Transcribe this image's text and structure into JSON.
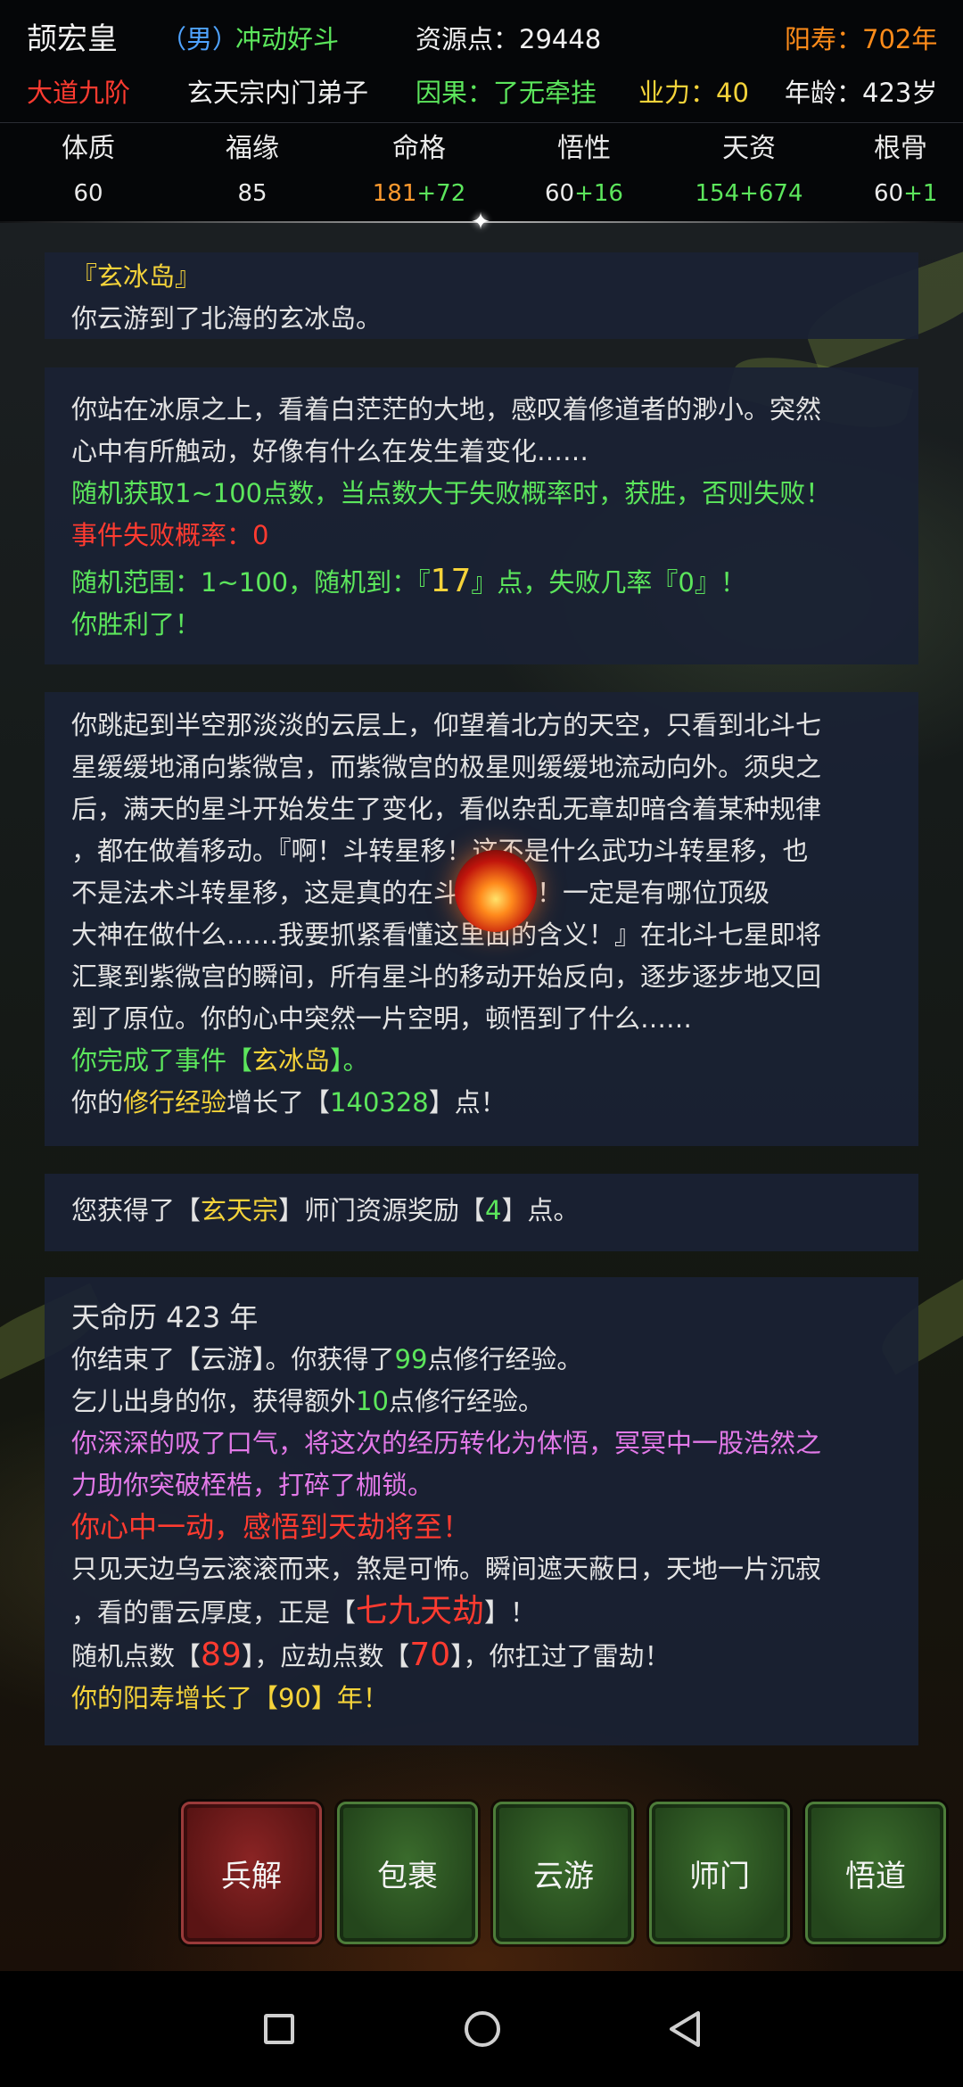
{
  "header": {
    "name": "颉宏皇",
    "gender": "（男）",
    "personality": "冲动好斗",
    "resource_points": "资源点：29448",
    "lifespan": "阳寿：702年",
    "realm": "大道九阶",
    "sect_role": "玄天宗内门弟子",
    "karma": "因果：了无牵挂",
    "karma_power": "业力：40",
    "age": "年龄：423岁"
  },
  "stats": [
    {
      "label": "体质",
      "base": "60",
      "bonus": ""
    },
    {
      "label": "福缘",
      "base": "85",
      "bonus": ""
    },
    {
      "label": "命格",
      "base": "181",
      "bonus": "+72"
    },
    {
      "label": "悟性",
      "base": "60",
      "bonus": "+16"
    },
    {
      "label": "天资",
      "base": "154+674",
      "bonus": ""
    },
    {
      "label": "根骨",
      "base": "60",
      "bonus": "+1"
    }
  ],
  "log": {
    "card1": {
      "title": "『玄冰岛』",
      "line": "你云游到了北海的玄冰岛。"
    },
    "card2": {
      "l1": "你站在冰原之上，看着白茫茫的大地，感叹着修道者的渺小。突然",
      "l2": "心中有所触动，好像有什么在发生着变化……",
      "l3": "随机获取1~100点数，当点数大于失败概率时，获胜，否则失败！",
      "l4": "事件失败概率：0",
      "l5a": "随机范围：1~100，随机到：『",
      "l5b": "17",
      "l5c": "』点，失败几率『0』！",
      "l6": "你胜利了！"
    },
    "card3": {
      "l1": "你跳起到半空那淡淡的云层上，仰望着北方的天空，只看到北斗七",
      "l2": "星缓缓地涌向紫微宫，而紫微宫的极星则缓缓地流动向外。须臾之",
      "l3": "后，满天的星斗开始发生了变化，看似杂乱无章却暗含着某种规律",
      "l4": "，都在做着移动。『啊！斗转星移！这不是什么武功斗转星移，也",
      "l5": "不是法术斗转星移，这是真的在斗转星移！一定是有哪位顶级",
      "l6": "大神在做什么……我要抓紧看懂这里面的含义！』在北斗七星即将",
      "l7": "汇聚到紫微宫的瞬间，所有星斗的移动开始反向，逐步逐步地又回",
      "l8": "到了原位。你的心中突然一片空明，顿悟到了什么……",
      "l9a": "你完成了事件【",
      "l9b": "玄冰岛",
      "l9c": "】。",
      "l10a": "你的",
      "l10b": "修行经验",
      "l10c": "增长了【",
      "l10d": "140328",
      "l10e": "】点！"
    },
    "card4": {
      "a": "您获得了【",
      "b": "玄天宗",
      "c": "】师门资源奖励【",
      "d": "4",
      "e": "】点。"
    },
    "card5": {
      "title": "天命历 423 年",
      "l1a": "你结束了【云游】。你获得了",
      "l1b": "99",
      "l1c": "点修行经验。",
      "l2a": "乞儿出身的你，获得额外",
      "l2b": "10",
      "l2c": "点修行经验。",
      "l3": "你深深的吸了口气，将这次的经历转化为体悟，冥冥中一股浩然之",
      "l4": "力助你突破桎梏，打碎了枷锁。",
      "l5": "你心中一动，感悟到天劫将至！",
      "l6": "只见天边乌云滚滚而来，煞是可怖。瞬间遮天蔽日，天地一片沉寂",
      "l7a": "，看的雷云厚度，正是【",
      "l7b": "七九天劫",
      "l7c": "】！",
      "l8a": "随机点数【",
      "l8b": "89",
      "l8c": "】，应劫点数【",
      "l8d": "70",
      "l8e": "】，你扛过了雷劫！",
      "l9": "你的阳寿增长了【90】年！"
    }
  },
  "actions": {
    "dissolve": "兵解",
    "bag": "包裹",
    "travel": "云游",
    "sect": "师门",
    "enlighten": "悟道"
  }
}
